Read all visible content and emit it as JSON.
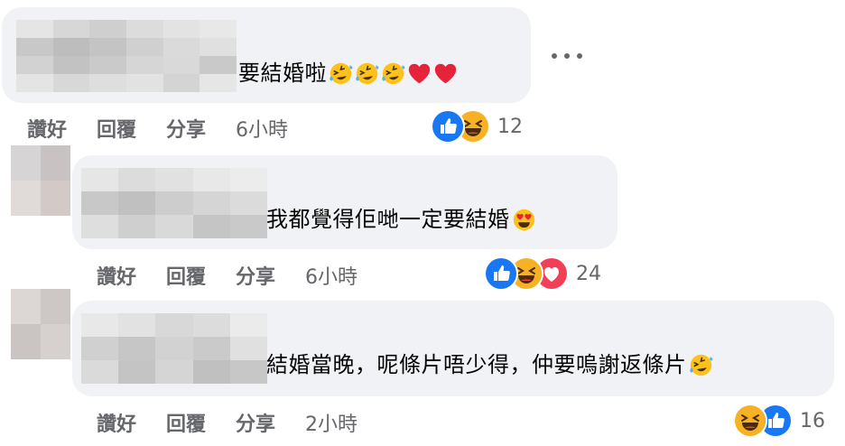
{
  "comments": [
    {
      "text": "要結婚啦",
      "emojis": [
        "rolling-laugh-emoji",
        "rolling-laugh-emoji",
        "rolling-laugh-emoji",
        "red-heart-emoji",
        "red-heart-emoji"
      ],
      "actions": {
        "like": "讚好",
        "reply": "回覆",
        "share": "分享",
        "time": "6小時"
      },
      "reactions": [
        "like",
        "haha"
      ],
      "reaction_count": "12"
    },
    {
      "text": "我都覺得佢哋一定要結婚",
      "emojis": [
        "heart-eyes-emoji"
      ],
      "actions": {
        "like": "讚好",
        "reply": "回覆",
        "share": "分享",
        "time": "6小時"
      },
      "reactions": [
        "like",
        "haha",
        "love"
      ],
      "reaction_count": "24"
    },
    {
      "text": "結婚當晚，呢條片唔少得，仲要嗚謝返條片",
      "emojis": [
        "rolling-laugh-emoji"
      ],
      "actions": {
        "like": "讚好",
        "reply": "回覆",
        "share": "分享",
        "time": "2小時"
      },
      "reactions": [
        "haha",
        "like"
      ],
      "reaction_count": "16"
    }
  ],
  "colors": {
    "bubble": "#f0f2f5",
    "meta": "#65676b",
    "like": "#1877f2",
    "love": "#f33e58",
    "haha": "#f7b125"
  }
}
